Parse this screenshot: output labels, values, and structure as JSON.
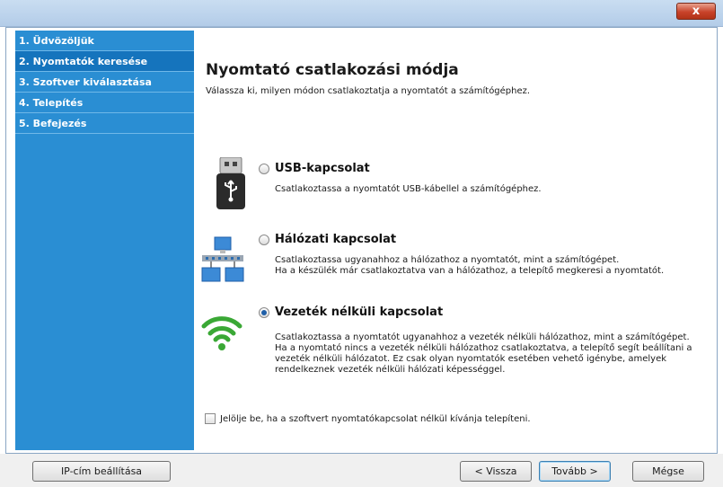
{
  "window": {
    "close_label": "x"
  },
  "sidebar": {
    "items": [
      {
        "label": "1. Üdvözöljük"
      },
      {
        "label": "2. Nyomtatók keresése"
      },
      {
        "label": "3. Szoftver kiválasztása"
      },
      {
        "label": "4. Telepítés"
      },
      {
        "label": "5. Befejezés"
      }
    ]
  },
  "main": {
    "title": "Nyomtató csatlakozási módja",
    "subtitle": "Válassza ki, milyen módon csatlakoztatja a nyomtatót a számítógéphez.",
    "options": [
      {
        "title": "USB-kapcsolat",
        "icon": "usb-icon",
        "selected": false,
        "description": [
          "Csatlakoztassa a nyomtatót USB-kábellel a számítógéphez."
        ]
      },
      {
        "title": "Hálózati kapcsolat",
        "icon": "network-icon",
        "selected": false,
        "description": [
          "Csatlakoztassa ugyanahhoz a hálózathoz a nyomtatót, mint a számítógépet.",
          "Ha a készülék már csatlakoztatva van a hálózathoz, a telepítő megkeresi a nyomtatót."
        ]
      },
      {
        "title": "Vezeték nélküli kapcsolat",
        "icon": "wifi-icon",
        "selected": true,
        "description": [
          "Csatlakoztassa a nyomtatót ugyanahhoz a vezeték nélküli hálózathoz, mint a számítógépet.",
          "Ha a nyomtató nincs a vezeték nélküli hálózathoz csatlakoztatva, a telepítő segít beállítani a",
          "vezeték nélküli hálózatot. Ez csak olyan nyomtatók esetében vehető igénybe, amelyek",
          "rendelkeznek vezeték nélküli hálózati képességgel."
        ]
      }
    ],
    "checkbox": {
      "label": "Jelölje be, ha a szoftvert nyomtatókapcsolat nélkül kívánja telepíteni.",
      "checked": false
    }
  },
  "footer": {
    "ip_button": "IP-cím beállítása",
    "back_button": "< Vissza",
    "next_button": "Tovább >",
    "cancel_button": "Mégse"
  },
  "colors": {
    "sidebar": "#2a8ed3",
    "sidebar_active": "#1574bd",
    "wifi_green": "#3aa835",
    "close_button": "#c8432a"
  }
}
